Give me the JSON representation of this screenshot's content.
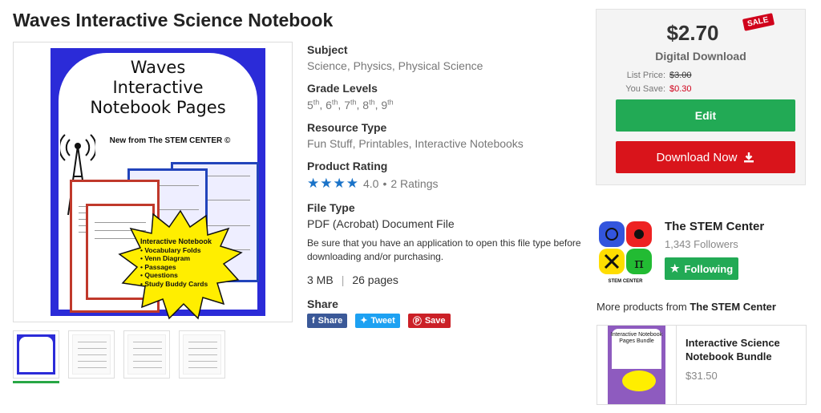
{
  "product": {
    "title": "Waves Interactive Science Notebook",
    "cover_title_lines": [
      "Waves",
      "Interactive",
      "Notebook Pages"
    ],
    "cover_subtitle": "New from The STEM CENTER ©",
    "cover_burst_title": "Interactive Notebook",
    "cover_burst_items": [
      "• Vocabulary Folds",
      "• Venn Diagram",
      "• Passages",
      "• Questions",
      "• Study Buddy Cards"
    ],
    "thumbnails": 4
  },
  "details": {
    "subject_label": "Subject",
    "subjects": [
      "Science",
      "Physics",
      "Physical Science"
    ],
    "grade_label": "Grade Levels",
    "grades": [
      {
        "num": "5",
        "suffix": "th"
      },
      {
        "num": "6",
        "suffix": "th"
      },
      {
        "num": "7",
        "suffix": "th"
      },
      {
        "num": "8",
        "suffix": "th"
      },
      {
        "num": "9",
        "suffix": "th"
      }
    ],
    "resource_label": "Resource Type",
    "resources": [
      "Fun Stuff",
      "Printables",
      "Interactive Notebooks"
    ],
    "rating_label": "Product Rating",
    "stars": "★★★★",
    "rating_value": "4.0",
    "rating_count": "2 Ratings",
    "filetype_label": "File Type",
    "filetype": "PDF (Acrobat) Document File",
    "filetype_note": "Be sure that you have an application to open this file type before downloading and/or purchasing.",
    "size": "3 MB",
    "pages": "26 pages",
    "share_label": "Share",
    "share_facebook": "Share",
    "share_twitter": "Tweet",
    "share_pinterest": "Save"
  },
  "buybox": {
    "price": "$2.70",
    "sale_tag": "SALE",
    "format": "Digital Download",
    "list_price_label": "List Price:",
    "list_price": "$3.00",
    "you_save_label": "You Save:",
    "you_save": "$0.30",
    "edit_label": "Edit",
    "download_label": "Download Now"
  },
  "seller": {
    "name": "The STEM Center",
    "followers": "1,343 Followers",
    "following_label": "Following",
    "logo_caption": "STEM CENTER",
    "more_prefix": "More products from",
    "more_name": "The STEM Center"
  },
  "related": {
    "title": "Interactive Science Notebook Bundle",
    "price": "$31.50",
    "cover_text": "Interactive Notebook Pages Bundle"
  },
  "colors": {
    "green": "#22aa55",
    "red": "#d9141b",
    "sale_red": "#d0021b",
    "star_blue": "#1a73c8"
  }
}
